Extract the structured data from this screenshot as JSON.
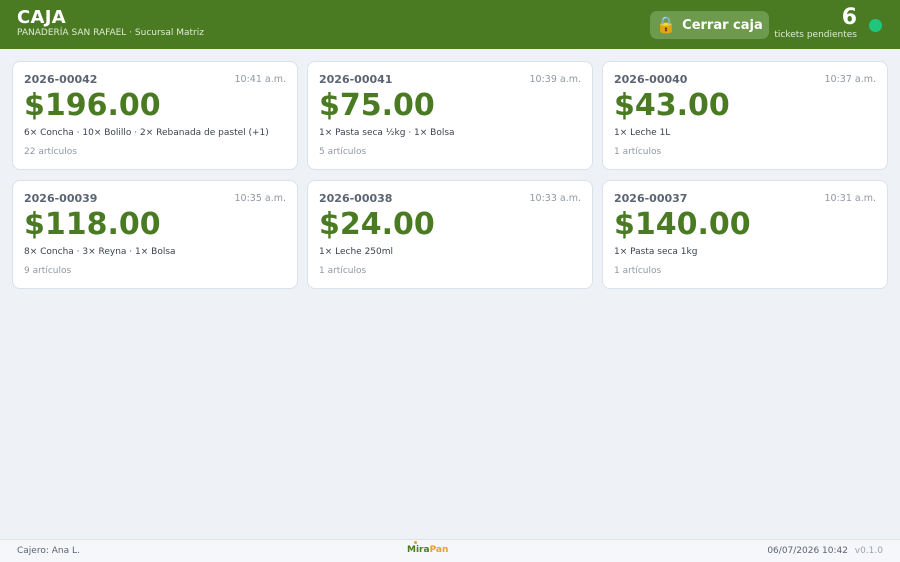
{
  "header": {
    "title": "CAJA",
    "subtitle": "PANADERÍA SAN RAFAEL · Sucursal Matriz",
    "close_button": {
      "icon": "lock-icon",
      "label": "Cerrar caja"
    },
    "pending": {
      "count": "6",
      "label": "tickets pendientes"
    },
    "status_color": "#1ec77d"
  },
  "tickets": [
    {
      "id": "2026-00042",
      "time": "10:41 a.m.",
      "total": "$196.00",
      "items": "6× Concha · 10× Bolillo · 2× Rebanada de pastel (+1)",
      "count": "22 artículos"
    },
    {
      "id": "2026-00041",
      "time": "10:39 a.m.",
      "total": "$75.00",
      "items": "1× Pasta seca ½kg · 1× Bolsa",
      "count": "5 artículos"
    },
    {
      "id": "2026-00040",
      "time": "10:37 a.m.",
      "total": "$43.00",
      "items": "1× Leche 1L",
      "count": "1 artículos"
    },
    {
      "id": "2026-00039",
      "time": "10:35 a.m.",
      "total": "$118.00",
      "items": "8× Concha · 3× Reyna · 1× Bolsa",
      "count": "9 artículos"
    },
    {
      "id": "2026-00038",
      "time": "10:33 a.m.",
      "total": "$24.00",
      "items": "1× Leche 250ml",
      "count": "1 artículos"
    },
    {
      "id": "2026-00037",
      "time": "10:31 a.m.",
      "total": "$140.00",
      "items": "1× Pasta seca 1kg",
      "count": "1 artículos"
    }
  ],
  "footer": {
    "cashier": "Cajero: Ana L.",
    "logo_part1": "Mira",
    "logo_part2": "Pan",
    "datetime": "06/07/2026 10:42",
    "version": "v0.1.0"
  },
  "colors": {
    "brand": "#4a7b23",
    "accent": "#e8a12a",
    "status": "#1ec77d"
  }
}
